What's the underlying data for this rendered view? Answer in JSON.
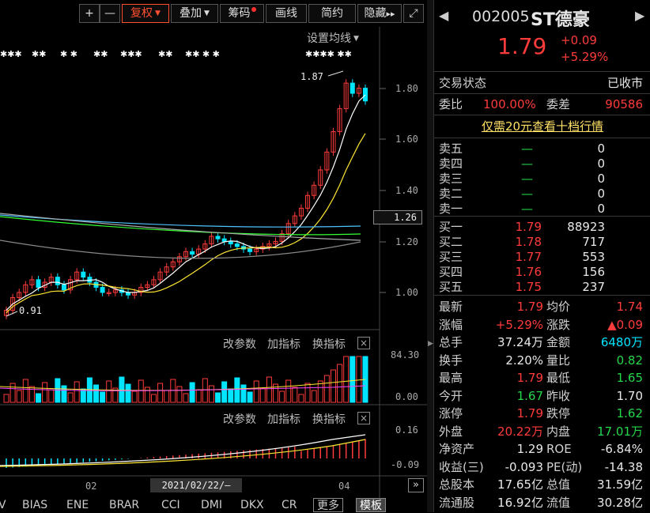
{
  "toolbar": {
    "plus": "+",
    "minus": "—",
    "fuquan": "复权",
    "diejia": "叠加",
    "chouma": "筹码",
    "huaxian": "画线",
    "jianyue": "简约",
    "yincang": "隐藏",
    "yincang_arrows": "▸▸",
    "fullscreen": "⤢"
  },
  "chart": {
    "ma_settings": "设置均线",
    "price_ticks": [
      "1.80",
      "1.60",
      "1.40",
      "1.20",
      "1.00"
    ],
    "current_price_tag": "1.26",
    "high_annotation": "1.87",
    "low_annotation": "0.91",
    "signal_marks": [
      "✱✱✱",
      "✱✱",
      "✱ ✱",
      "✱✱",
      "✱✱✱",
      "✱✱",
      "✱✱ ✱ ✱",
      "✱✱✱✱ ✱✱"
    ],
    "vol_panel": {
      "btn_params": "改参数",
      "btn_add": "加指标",
      "btn_switch": "换指标",
      "close": "×",
      "ticks": [
        "84.30",
        "0.00"
      ]
    },
    "macd_panel": {
      "btn_params": "改参数",
      "btn_add": "加指标",
      "btn_switch": "换指标",
      "close": "×",
      "ticks": [
        "0.16",
        "-0.09"
      ]
    },
    "x_labels": [
      "02",
      "04"
    ],
    "date_cursor": "2021/02/22/—",
    "scroll_right": "»"
  },
  "bottom_tabs": [
    "V",
    "BIAS",
    "ENE",
    "BRAR",
    "CCI",
    "DMI",
    "DKX",
    "CR",
    "更多",
    "模板"
  ],
  "quote": {
    "prev_arrow": "◀",
    "next_arrow": "▶",
    "code": "002005",
    "name": "ST德豪",
    "price": "1.79",
    "change": "+0.09",
    "change_pct": "+5.29%",
    "status_label": "交易状态",
    "status_value": "已收市",
    "weibi_label": "委比",
    "weibi_value": "100.00%",
    "weicha_label": "委差",
    "weicha_value": "90586",
    "promo": "仅需20元查看十档行情",
    "asks": [
      {
        "label": "卖五",
        "price": "—",
        "vol": "0"
      },
      {
        "label": "卖四",
        "price": "—",
        "vol": "0"
      },
      {
        "label": "卖三",
        "price": "—",
        "vol": "0"
      },
      {
        "label": "卖二",
        "price": "—",
        "vol": "0"
      },
      {
        "label": "卖一",
        "price": "—",
        "vol": "0"
      }
    ],
    "bids": [
      {
        "label": "买一",
        "price": "1.79",
        "vol": "88923"
      },
      {
        "label": "买二",
        "price": "1.78",
        "vol": "717"
      },
      {
        "label": "买三",
        "price": "1.77",
        "vol": "553"
      },
      {
        "label": "买四",
        "price": "1.76",
        "vol": "156"
      },
      {
        "label": "买五",
        "price": "1.75",
        "vol": "237"
      }
    ],
    "stats": [
      {
        "l1": "最新",
        "v1": "1.79",
        "c1": "red",
        "l2": "均价",
        "v2": "1.74",
        "c2": "red"
      },
      {
        "l1": "涨幅",
        "v1": "+5.29%",
        "c1": "red",
        "l2": "涨跌",
        "v2": "▲0.09",
        "c2": "red"
      },
      {
        "l1": "总手",
        "v1": "37.24万",
        "c1": "wht",
        "l2": "金额",
        "v2": "6480万",
        "c2": "cyan"
      },
      {
        "l1": "换手",
        "v1": "2.20%",
        "c1": "wht",
        "l2": "量比",
        "v2": "0.82",
        "c2": "grn"
      },
      {
        "l1": "最高",
        "v1": "1.79",
        "c1": "red",
        "l2": "最低",
        "v2": "1.65",
        "c2": "grn"
      },
      {
        "l1": "今开",
        "v1": "1.67",
        "c1": "grn",
        "l2": "昨收",
        "v2": "1.70",
        "c2": "wht"
      },
      {
        "l1": "涨停",
        "v1": "1.79",
        "c1": "red",
        "l2": "跌停",
        "v2": "1.62",
        "c2": "grn"
      },
      {
        "l1": "外盘",
        "v1": "20.22万",
        "c1": "red",
        "l2": "内盘",
        "v2": "17.01万",
        "c2": "grn"
      },
      {
        "l1": "净资产",
        "v1": "1.29",
        "c1": "wht",
        "l2": "ROE",
        "v2": "-6.84%",
        "c2": "wht"
      },
      {
        "l1": "收益(三)",
        "v1": "-0.093",
        "c1": "wht",
        "l2": "PE(动)",
        "v2": "-14.38",
        "c2": "wht"
      },
      {
        "l1": "总股本",
        "v1": "17.65亿",
        "c1": "wht",
        "l2": "总值",
        "v2": "31.59亿",
        "c2": "wht"
      },
      {
        "l1": "流通股",
        "v1": "16.92亿",
        "c1": "wht",
        "l2": "流值",
        "v2": "30.28亿",
        "c2": "wht"
      }
    ]
  },
  "colors": {
    "up": "#ff3b3b",
    "down": "#00e5ff",
    "ma5": "#ffffff",
    "ma10": "#ffe633",
    "ma20": "#ff44ff",
    "ma60": "#33ff33",
    "ma120": "#4fc3ff",
    "ma250": "#aaaaaa"
  }
}
